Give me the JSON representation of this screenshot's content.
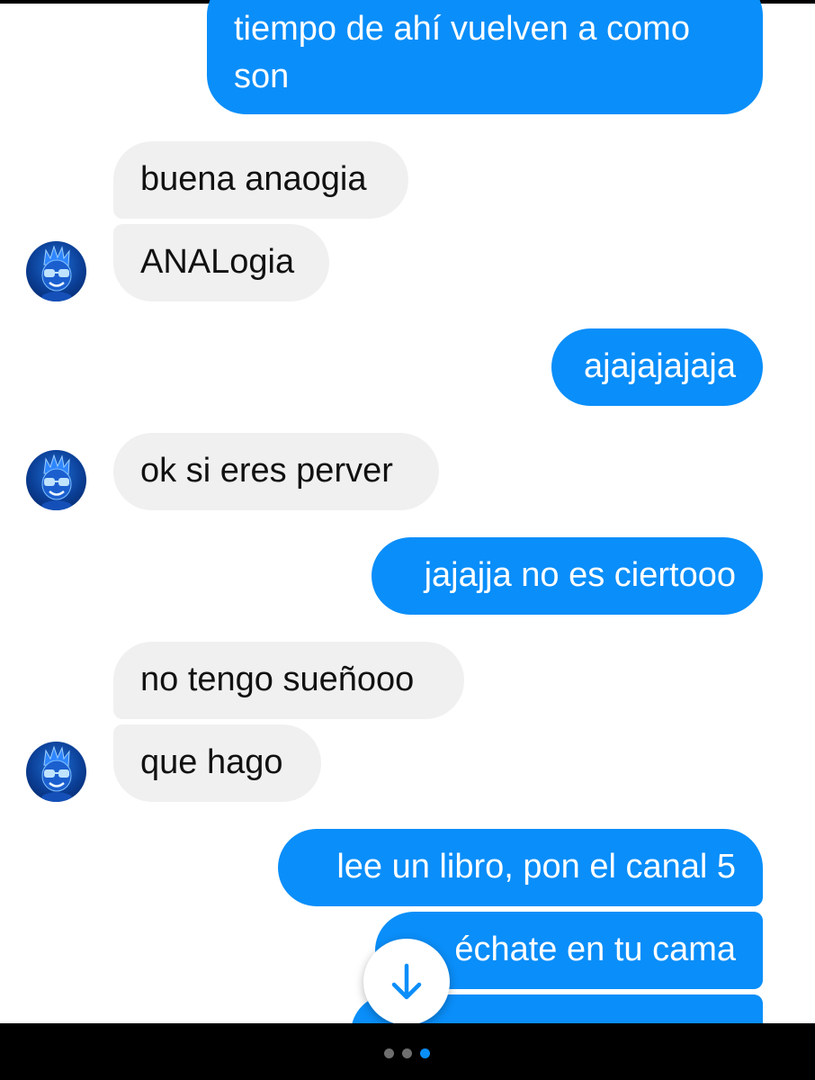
{
  "conversation": {
    "messages": [
      {
        "direction": "outgoing",
        "text_lines": [
          "tiempo de ahí vuelven a como",
          "son"
        ]
      },
      {
        "direction": "incoming",
        "text": "buena anaogia"
      },
      {
        "direction": "incoming",
        "text": "ANALogia"
      },
      {
        "direction": "outgoing",
        "text": "ajajajajaja"
      },
      {
        "direction": "incoming",
        "text": "ok si eres perver"
      },
      {
        "direction": "outgoing",
        "text": "jajajja no es ciertooo"
      },
      {
        "direction": "incoming",
        "text": "no tengo sueñooo"
      },
      {
        "direction": "incoming",
        "text": "que hago"
      },
      {
        "direction": "outgoing",
        "text": "lee un libro, pon el canal 5"
      },
      {
        "direction": "outgoing",
        "text": "échate en tu cama"
      }
    ]
  },
  "avatar_icon": "cartoon-boy-with-glasses-avatar",
  "scroll_button_icon": "arrow-down-icon",
  "page_indicator": {
    "count": 3,
    "active_index": 2
  },
  "colors": {
    "outgoing_bubble": "#0a8ef9",
    "incoming_bubble": "#f0f0f0",
    "background": "#ffffff",
    "accent": "#0a8ef9"
  }
}
